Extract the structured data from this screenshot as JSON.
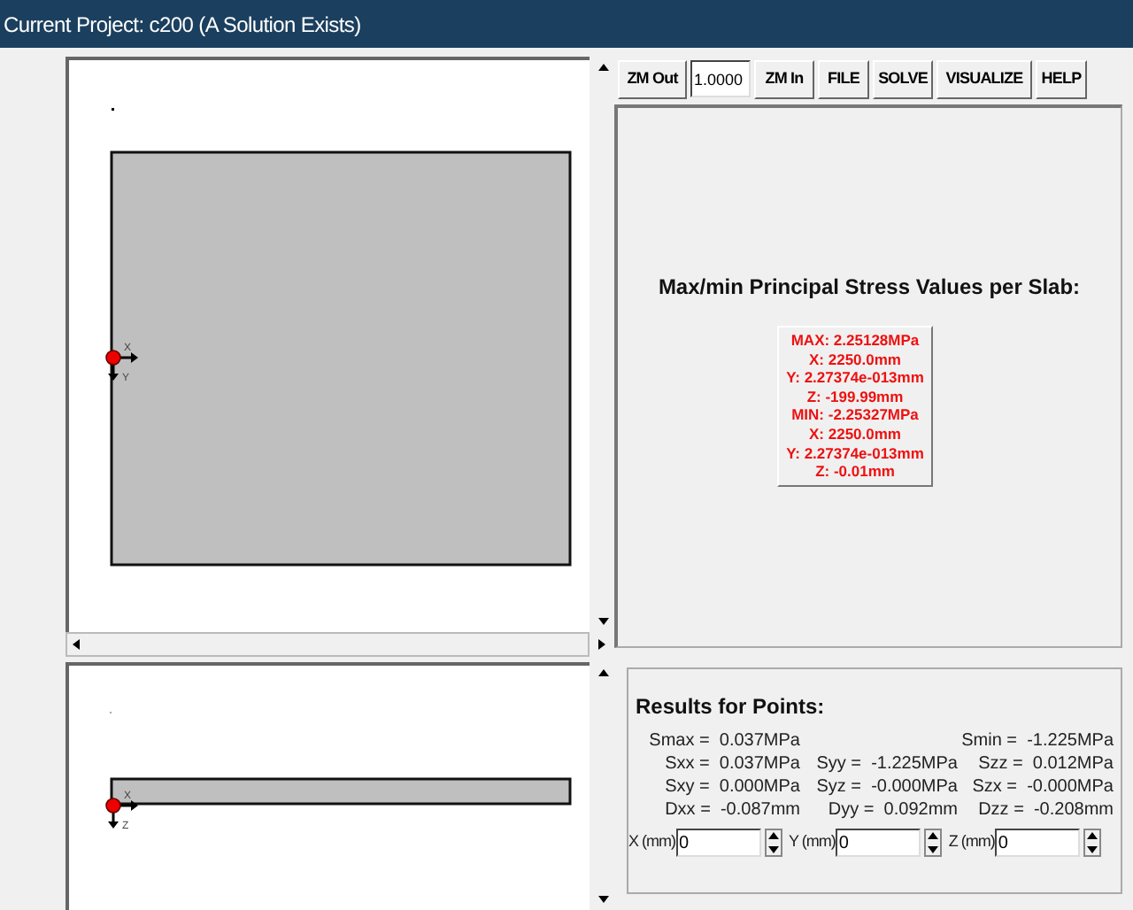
{
  "window": {
    "title": "Current Project: c200 (A Solution Exists)"
  },
  "top_view": {
    "axis_labels": [
      "X",
      "Y"
    ]
  },
  "side_view": {
    "axis_labels": [
      "X",
      "Z"
    ]
  },
  "toolbar": [
    {
      "kind": "button",
      "label": "ZM Out"
    },
    {
      "kind": "field",
      "value": "1.0000"
    },
    {
      "kind": "button",
      "label": "ZM In"
    },
    {
      "kind": "button",
      "label": "FILE"
    },
    {
      "kind": "button",
      "label": "SOLVE"
    },
    {
      "kind": "button",
      "label": "VISUALIZE"
    },
    {
      "kind": "button",
      "label": "HELP"
    }
  ],
  "stress_panel": {
    "heading": "Max/min Principal Stress Values per Slab:",
    "values": [
      "MAX: 2.25128MPa",
      "X: 2250.0mm",
      "Y: 2.27374e-013mm",
      "Z: -199.99mm",
      "MIN: -2.25327MPa",
      "X: 2250.0mm",
      "Y: 2.27374e-013mm",
      "Z: -0.01mm"
    ]
  },
  "results": {
    "heading": "Results for Points:",
    "rows": [
      [
        {
          "label": "Smax =",
          "value": "0.037MPa"
        },
        null,
        {
          "label": "Smin =",
          "value": "-1.225MPa"
        }
      ],
      [
        {
          "label": "Sxx =",
          "value": "0.037MPa"
        },
        {
          "label": "Syy =",
          "value": "-1.225MPa"
        },
        {
          "label": "Szz =",
          "value": "0.012MPa"
        }
      ],
      [
        {
          "label": "Sxy =",
          "value": "0.000MPa"
        },
        {
          "label": "Syz =",
          "value": "-0.000MPa"
        },
        {
          "label": "Szx =",
          "value": "-0.000MPa"
        }
      ],
      [
        {
          "label": "Dxx =",
          "value": "-0.087mm"
        },
        {
          "label": "Dyy =",
          "value": "0.092mm"
        },
        {
          "label": "Dzz =",
          "value": "-0.208mm"
        }
      ]
    ],
    "fields": [
      {
        "label": "X (mm)",
        "value": "0"
      },
      {
        "label": "Y (mm)",
        "value": "0"
      },
      {
        "label": "Z (mm)",
        "value": "0"
      }
    ]
  }
}
